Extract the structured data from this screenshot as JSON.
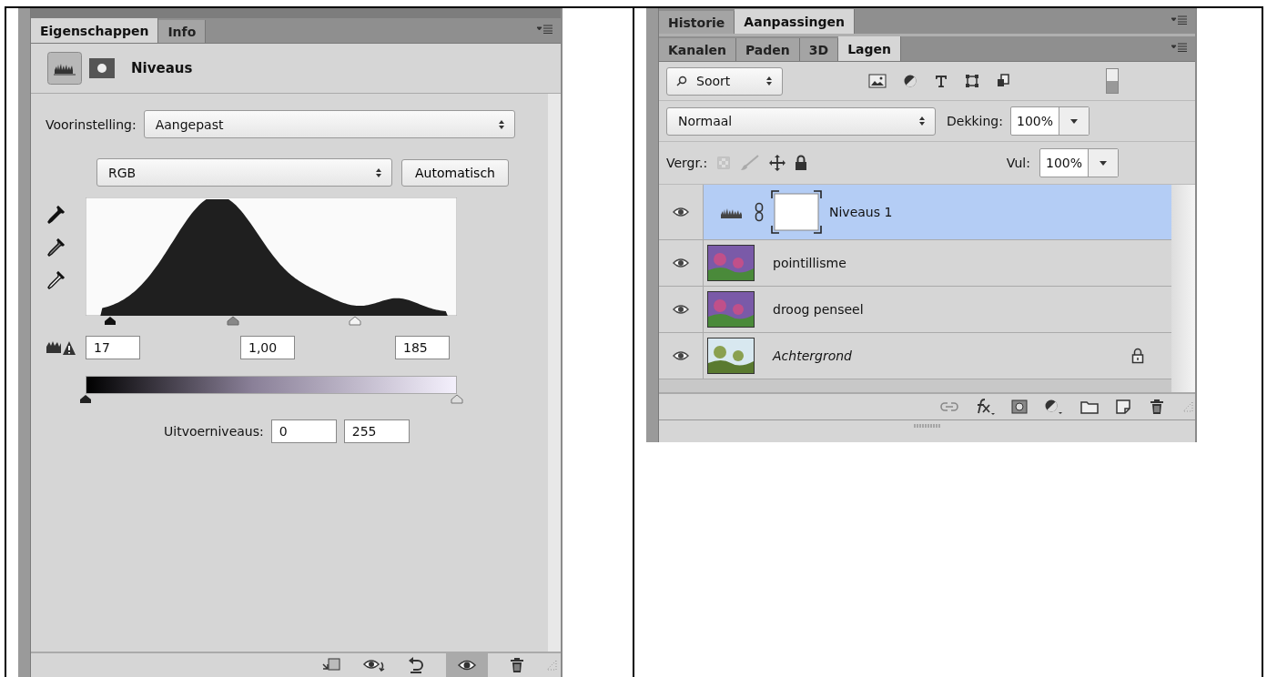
{
  "properties_panel": {
    "tabs": [
      {
        "label": "Eigenschappen",
        "selected": true
      },
      {
        "label": "Info",
        "selected": false
      }
    ],
    "title": "Niveaus",
    "preset": {
      "label": "Voorinstelling:",
      "value": "Aangepast"
    },
    "channel": {
      "value": "RGB"
    },
    "auto_button": "Automatisch",
    "input_levels": [
      "17",
      "1,00",
      "185"
    ],
    "output_levels": {
      "label": "Uitvoerniveaus:",
      "values": [
        "0",
        "255"
      ]
    },
    "visibility_toggle": {
      "on": true
    }
  },
  "layers_panel": {
    "top_tabs": [
      {
        "label": "Historie",
        "selected": false
      },
      {
        "label": "Aanpassingen",
        "selected": true
      }
    ],
    "tabs": [
      {
        "label": "Kanalen",
        "selected": false
      },
      {
        "label": "Paden",
        "selected": false
      },
      {
        "label": "3D",
        "selected": false
      },
      {
        "label": "Lagen",
        "selected": true
      }
    ],
    "filter": {
      "value": "Soort"
    },
    "blend_mode": {
      "value": "Normaal"
    },
    "opacity": {
      "label": "Dekking:",
      "value": "100%"
    },
    "lock_label": "Vergr.:",
    "fill": {
      "label": "Vul:",
      "value": "100%"
    },
    "layers": [
      {
        "name": "Niveaus 1",
        "kind": "adjustment",
        "selected": true,
        "visible": true,
        "locked": false
      },
      {
        "name": "pointillisme",
        "kind": "pixel",
        "selected": false,
        "visible": true,
        "locked": false
      },
      {
        "name": "droog penseel",
        "kind": "pixel",
        "selected": false,
        "visible": true,
        "locked": false
      },
      {
        "name": "Achtergrond",
        "kind": "background",
        "selected": false,
        "visible": true,
        "locked": true
      }
    ]
  }
}
